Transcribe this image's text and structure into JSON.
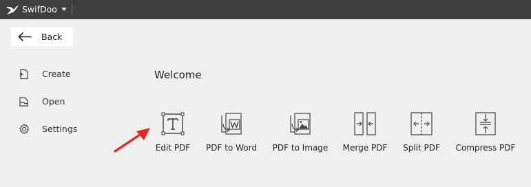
{
  "titlebar": {
    "app_name": "SwifDoo"
  },
  "back": {
    "label": "Back"
  },
  "sidebar": {
    "items": [
      {
        "label": "Create",
        "icon": "create-file-icon"
      },
      {
        "label": "Open",
        "icon": "open-folder-icon"
      },
      {
        "label": "Settings",
        "icon": "gear-icon"
      }
    ]
  },
  "main": {
    "welcome": "Welcome",
    "tools": [
      {
        "label": "Edit PDF",
        "icon": "edit-text-icon"
      },
      {
        "label": "PDF to Word",
        "icon": "word-convert-icon"
      },
      {
        "label": "PDF to Image",
        "icon": "image-convert-icon"
      },
      {
        "label": "Merge PDF",
        "icon": "merge-icon"
      },
      {
        "label": "Split PDF",
        "icon": "split-icon"
      },
      {
        "label": "Compress PDF",
        "icon": "compress-icon"
      }
    ]
  },
  "colors": {
    "titlebar_bg": "#3f3f3f",
    "page_bg": "#f0f0f0",
    "annotation_arrow": "#e8261d"
  }
}
